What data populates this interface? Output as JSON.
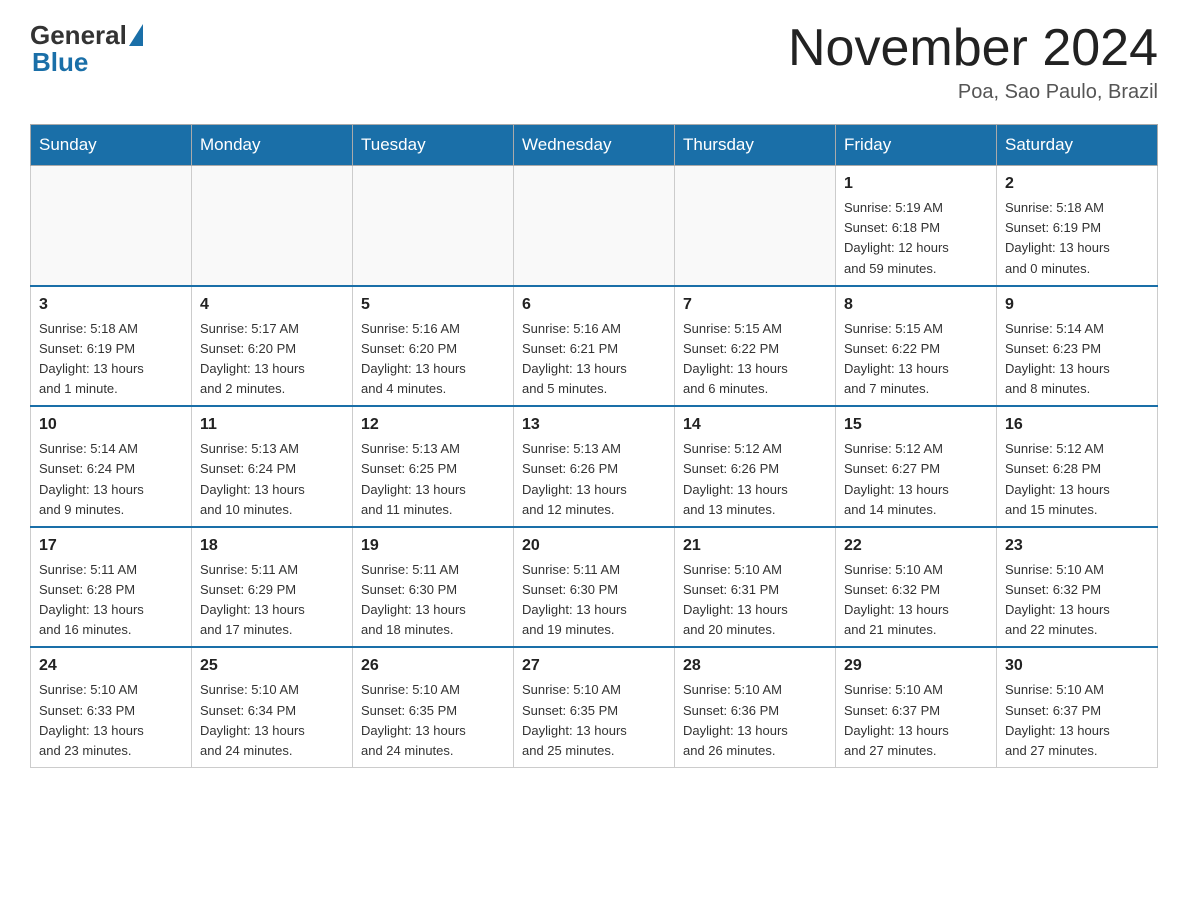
{
  "header": {
    "logo_general": "General",
    "logo_blue": "Blue",
    "title": "November 2024",
    "location": "Poa, Sao Paulo, Brazil"
  },
  "weekdays": [
    "Sunday",
    "Monday",
    "Tuesday",
    "Wednesday",
    "Thursday",
    "Friday",
    "Saturday"
  ],
  "weeks": [
    [
      {
        "day": "",
        "info": ""
      },
      {
        "day": "",
        "info": ""
      },
      {
        "day": "",
        "info": ""
      },
      {
        "day": "",
        "info": ""
      },
      {
        "day": "",
        "info": ""
      },
      {
        "day": "1",
        "info": "Sunrise: 5:19 AM\nSunset: 6:18 PM\nDaylight: 12 hours\nand 59 minutes."
      },
      {
        "day": "2",
        "info": "Sunrise: 5:18 AM\nSunset: 6:19 PM\nDaylight: 13 hours\nand 0 minutes."
      }
    ],
    [
      {
        "day": "3",
        "info": "Sunrise: 5:18 AM\nSunset: 6:19 PM\nDaylight: 13 hours\nand 1 minute."
      },
      {
        "day": "4",
        "info": "Sunrise: 5:17 AM\nSunset: 6:20 PM\nDaylight: 13 hours\nand 2 minutes."
      },
      {
        "day": "5",
        "info": "Sunrise: 5:16 AM\nSunset: 6:20 PM\nDaylight: 13 hours\nand 4 minutes."
      },
      {
        "day": "6",
        "info": "Sunrise: 5:16 AM\nSunset: 6:21 PM\nDaylight: 13 hours\nand 5 minutes."
      },
      {
        "day": "7",
        "info": "Sunrise: 5:15 AM\nSunset: 6:22 PM\nDaylight: 13 hours\nand 6 minutes."
      },
      {
        "day": "8",
        "info": "Sunrise: 5:15 AM\nSunset: 6:22 PM\nDaylight: 13 hours\nand 7 minutes."
      },
      {
        "day": "9",
        "info": "Sunrise: 5:14 AM\nSunset: 6:23 PM\nDaylight: 13 hours\nand 8 minutes."
      }
    ],
    [
      {
        "day": "10",
        "info": "Sunrise: 5:14 AM\nSunset: 6:24 PM\nDaylight: 13 hours\nand 9 minutes."
      },
      {
        "day": "11",
        "info": "Sunrise: 5:13 AM\nSunset: 6:24 PM\nDaylight: 13 hours\nand 10 minutes."
      },
      {
        "day": "12",
        "info": "Sunrise: 5:13 AM\nSunset: 6:25 PM\nDaylight: 13 hours\nand 11 minutes."
      },
      {
        "day": "13",
        "info": "Sunrise: 5:13 AM\nSunset: 6:26 PM\nDaylight: 13 hours\nand 12 minutes."
      },
      {
        "day": "14",
        "info": "Sunrise: 5:12 AM\nSunset: 6:26 PM\nDaylight: 13 hours\nand 13 minutes."
      },
      {
        "day": "15",
        "info": "Sunrise: 5:12 AM\nSunset: 6:27 PM\nDaylight: 13 hours\nand 14 minutes."
      },
      {
        "day": "16",
        "info": "Sunrise: 5:12 AM\nSunset: 6:28 PM\nDaylight: 13 hours\nand 15 minutes."
      }
    ],
    [
      {
        "day": "17",
        "info": "Sunrise: 5:11 AM\nSunset: 6:28 PM\nDaylight: 13 hours\nand 16 minutes."
      },
      {
        "day": "18",
        "info": "Sunrise: 5:11 AM\nSunset: 6:29 PM\nDaylight: 13 hours\nand 17 minutes."
      },
      {
        "day": "19",
        "info": "Sunrise: 5:11 AM\nSunset: 6:30 PM\nDaylight: 13 hours\nand 18 minutes."
      },
      {
        "day": "20",
        "info": "Sunrise: 5:11 AM\nSunset: 6:30 PM\nDaylight: 13 hours\nand 19 minutes."
      },
      {
        "day": "21",
        "info": "Sunrise: 5:10 AM\nSunset: 6:31 PM\nDaylight: 13 hours\nand 20 minutes."
      },
      {
        "day": "22",
        "info": "Sunrise: 5:10 AM\nSunset: 6:32 PM\nDaylight: 13 hours\nand 21 minutes."
      },
      {
        "day": "23",
        "info": "Sunrise: 5:10 AM\nSunset: 6:32 PM\nDaylight: 13 hours\nand 22 minutes."
      }
    ],
    [
      {
        "day": "24",
        "info": "Sunrise: 5:10 AM\nSunset: 6:33 PM\nDaylight: 13 hours\nand 23 minutes."
      },
      {
        "day": "25",
        "info": "Sunrise: 5:10 AM\nSunset: 6:34 PM\nDaylight: 13 hours\nand 24 minutes."
      },
      {
        "day": "26",
        "info": "Sunrise: 5:10 AM\nSunset: 6:35 PM\nDaylight: 13 hours\nand 24 minutes."
      },
      {
        "day": "27",
        "info": "Sunrise: 5:10 AM\nSunset: 6:35 PM\nDaylight: 13 hours\nand 25 minutes."
      },
      {
        "day": "28",
        "info": "Sunrise: 5:10 AM\nSunset: 6:36 PM\nDaylight: 13 hours\nand 26 minutes."
      },
      {
        "day": "29",
        "info": "Sunrise: 5:10 AM\nSunset: 6:37 PM\nDaylight: 13 hours\nand 27 minutes."
      },
      {
        "day": "30",
        "info": "Sunrise: 5:10 AM\nSunset: 6:37 PM\nDaylight: 13 hours\nand 27 minutes."
      }
    ]
  ]
}
